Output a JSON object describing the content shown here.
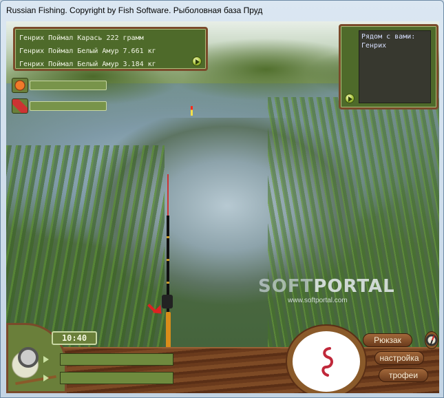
{
  "window": {
    "title": "Russian Fishing. Copyright by Fish Software. Рыболовная база Пруд"
  },
  "chat": {
    "lines": [
      "Генрих Поймал Карась 222 грамм",
      "Генрих Поймал Белый Амур 7.661 кг",
      "Генрих Поймал Белый Амур 3.184 кг"
    ]
  },
  "nearby": {
    "text": "Рядом с вами:\nГенрих"
  },
  "watermark": {
    "logo_a": "SOFT",
    "logo_b": "PORTAL",
    "url": "www.softportal.com"
  },
  "clock": {
    "time": "10:40"
  },
  "menu": {
    "backpack": "Рюкзак",
    "settings": "настройка",
    "trophies": "трофеи"
  },
  "icons": {
    "chat_send": "play-icon",
    "nearby_send": "play-icon",
    "bait": "bait-icon",
    "groundbait": "groundbait-icon",
    "reel": "reel-icon",
    "worm": "worm-icon",
    "compass": "compass-icon"
  },
  "colors": {
    "panel_green": "#4e6a2a",
    "wood": "#7a4a2a",
    "worm": "#c0283a"
  }
}
